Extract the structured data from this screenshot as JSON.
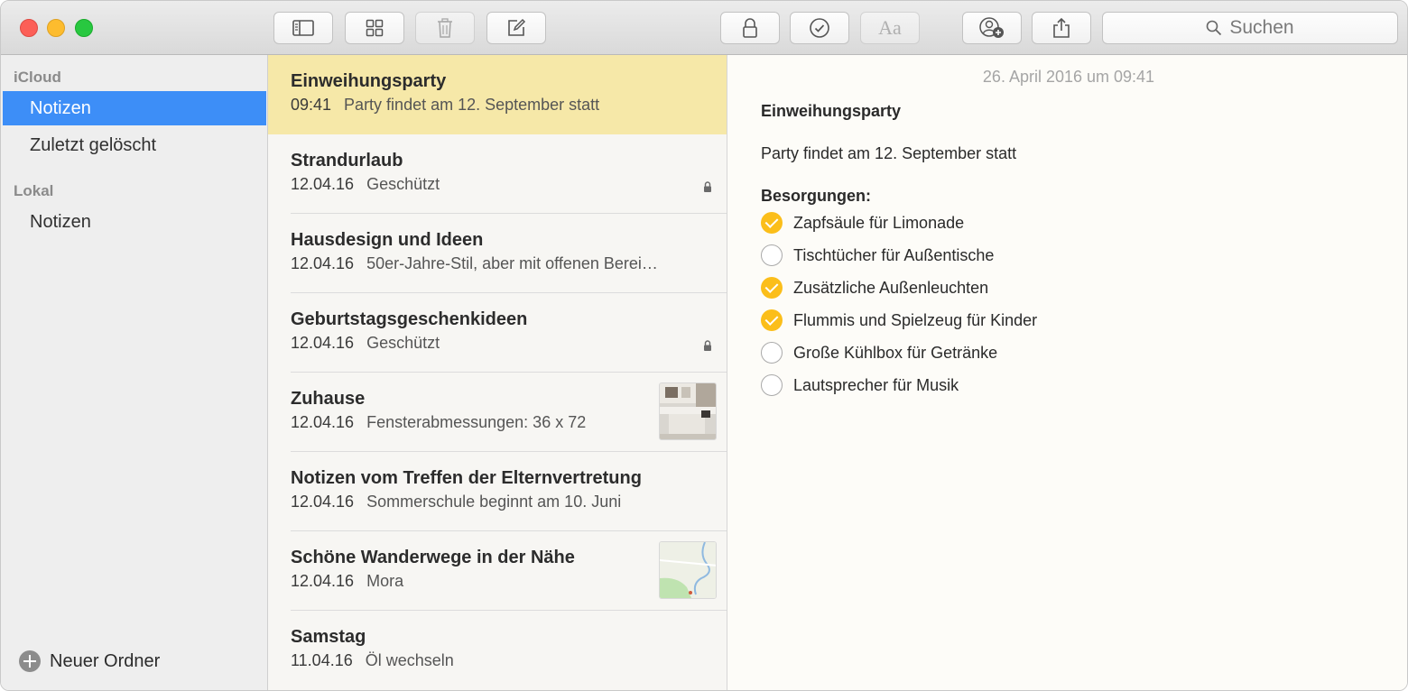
{
  "toolbar": {
    "buttons": [
      "sidebar-toggle-icon",
      "attachments-grid-icon",
      "trash-icon",
      "compose-icon",
      "lock-icon",
      "checklist-icon",
      "text-format-icon",
      "add-people-icon",
      "share-icon"
    ],
    "format_label": "Aa",
    "search_placeholder": "Suchen"
  },
  "sidebar": {
    "section_icloud": "iCloud",
    "icloud_items": [
      {
        "label": "Notizen",
        "selected": true
      },
      {
        "label": "Zuletzt gelöscht",
        "selected": false
      }
    ],
    "section_local": "Lokal",
    "local_items": [
      {
        "label": "Notizen",
        "selected": false
      }
    ],
    "new_folder_label": "Neuer Ordner"
  },
  "notes": [
    {
      "title": "Einweihungsparty",
      "date": "09:41",
      "preview": "Party findet am 12. September statt",
      "selected": true
    },
    {
      "title": "Strandurlaub",
      "date": "12.04.16",
      "preview": "Geschützt",
      "locked": true
    },
    {
      "title": "Hausdesign und Ideen",
      "date": "12.04.16",
      "preview": "50er-Jahre-Stil, aber mit offenen Berei…"
    },
    {
      "title": "Geburtstagsgeschenkideen",
      "date": "12.04.16",
      "preview": "Geschützt",
      "locked": true
    },
    {
      "title": "Zuhause",
      "date": "12.04.16",
      "preview": "Fensterabmessungen: 36 x 72",
      "thumbnail": "kitchen-photo"
    },
    {
      "title": "Notizen vom Treffen der Elternvertretung",
      "date": "12.04.16",
      "preview": "Sommerschule beginnt am 10. Juni"
    },
    {
      "title": "Schöne Wanderwege in der Nähe",
      "date": "12.04.16",
      "preview": "Mora",
      "thumbnail": "map-preview"
    },
    {
      "title": "Samstag",
      "date": "11.04.16",
      "preview": "Öl wechseln"
    }
  ],
  "editor": {
    "date": "26. April 2016 um 09:41",
    "title": "Einweihungsparty",
    "body": "Party findet am 12. September statt",
    "checklist_heading": "Besorgungen:",
    "checklist": [
      {
        "text": "Zapfsäule für Limonade",
        "checked": true
      },
      {
        "text": "Tischtücher für Außentische",
        "checked": false
      },
      {
        "text": "Zusätzliche Außenleuchten",
        "checked": true
      },
      {
        "text": "Flummis und Spielzeug für Kinder",
        "checked": true
      },
      {
        "text": "Große Kühlbox für Getränke",
        "checked": false
      },
      {
        "text": "Lautsprecher für Musik",
        "checked": false
      }
    ]
  },
  "colors": {
    "accent": "#3d8ef7",
    "selected_note": "#f6e8a8",
    "check": "#fbbe1a"
  }
}
